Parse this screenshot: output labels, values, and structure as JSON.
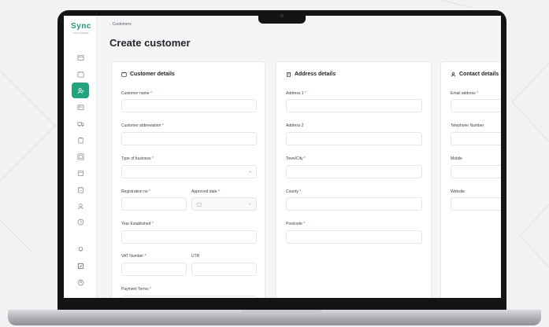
{
  "app": {
    "logo": "Sync",
    "logo_sub": "SOFTWARE"
  },
  "breadcrumb": {
    "item": "Customers"
  },
  "page_title": "Create customer",
  "customer_details": {
    "title": "Customer details",
    "customer_name": "Customer name",
    "customer_abbreviation": "Customer abbreviation",
    "type_of_business": "Type of business",
    "registration_no": "Registration no",
    "approved_date": "Approved date",
    "year_established": "Year Established",
    "vat_number": "VAT Number",
    "utr": "UTR",
    "payment_terms": "Payment Terms"
  },
  "address_details": {
    "title": "Address details",
    "address1": "Address 1",
    "address2": "Address 2",
    "town_city": "Town/City",
    "county": "County",
    "postcode": "Postcode"
  },
  "contact_details": {
    "title": "Contact details",
    "email": "Email address",
    "telephone": "Telephone Number",
    "mobile": "Mobile",
    "website": "Website"
  },
  "sidebar": {
    "items": [
      "dashboard-icon",
      "calendar-icon",
      "customers-icon",
      "id-card-icon",
      "vehicles-icon",
      "clipboard-icon",
      "grid-icon",
      "document-icon",
      "invoice-icon",
      "users-icon",
      "clock-icon"
    ],
    "bottom": [
      "bell-icon",
      "task-icon",
      "profile-icon"
    ]
  },
  "colors": {
    "accent": "#21a37d",
    "required": "#e24b4b"
  }
}
